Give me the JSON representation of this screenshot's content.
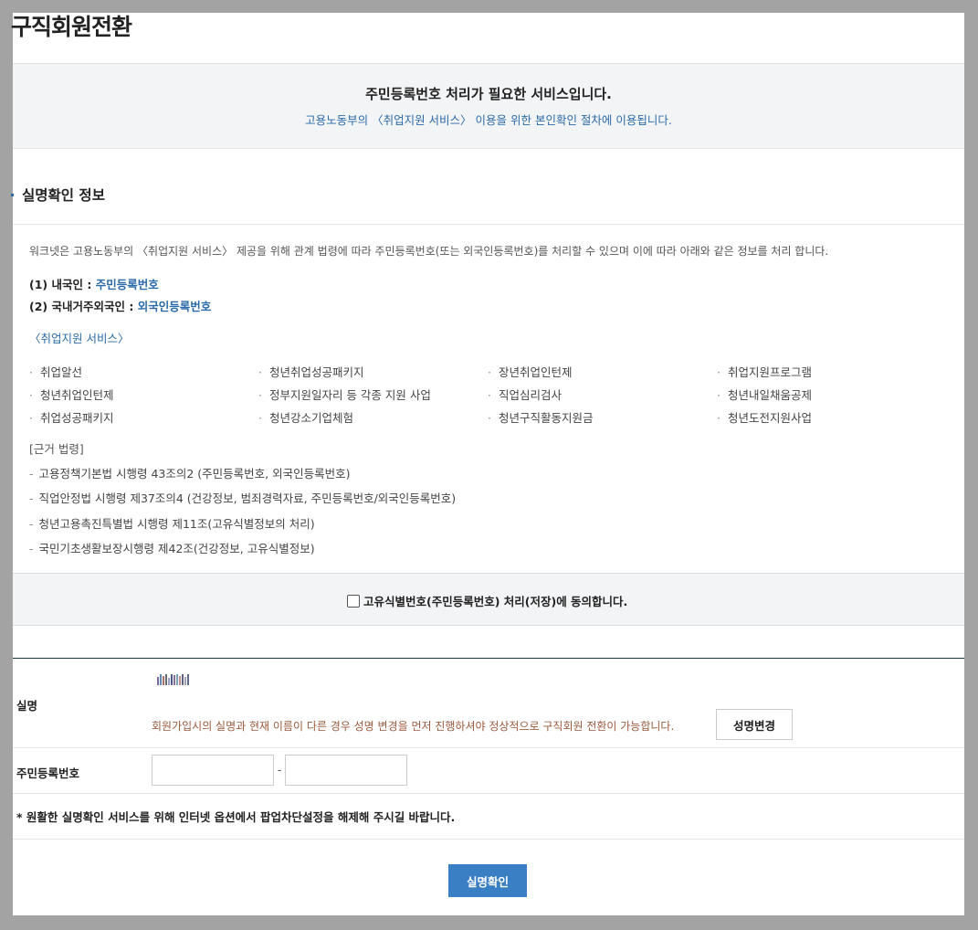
{
  "page": {
    "title": "구직회원전환"
  },
  "notice": {
    "line1": "주민등록번호 처리가 필요한 서비스입니다.",
    "line2": "고용노동부의 〈취업지원 서비스〉 이용을 위한 본인확인 절차에 이용됩니다."
  },
  "section": {
    "title": "실명확인 정보",
    "intro": "워크넷은 고용노동부의 〈취업지원 서비스〉 제공을 위해 관계 법령에 따라 주민등록번호(또는 외국인등록번호)를 처리할 수 있으며 이에 따라 아래와 같은 정보를 처리 합니다.",
    "id_types": [
      {
        "label": "(1) 내국인 : ",
        "value": "주민등록번호"
      },
      {
        "label": "(2) 국내거주외국인 : ",
        "value": "외국인등록번호"
      }
    ],
    "services_title": "〈취업지원 서비스〉",
    "services": [
      "취업알선",
      "청년취업성공패키지",
      "장년취업인턴제",
      "취업지원프로그램",
      "청년취업인턴제",
      "정부지원일자리 등 각종 지원 사업",
      "직업심리검사",
      "청년내일채움공제",
      "취업성공패키지",
      "청년강소기업체험",
      "청년구직활동지원금",
      "청년도전지원사업"
    ],
    "law_title": "[근거 법령]",
    "laws": [
      "고용정책기본법 시행령 43조의2 (주민등록번호, 외국인등록번호)",
      "직업안정법 시행령 제37조의4 (건강정보, 범죄경력자료, 주민등록번호/외국인등록번호)",
      "청년고용촉진특별법 시행령 제11조(고유식별정보의 처리)",
      "국민기초생활보장시행령 제42조(건강정보, 고유식별정보)"
    ]
  },
  "agree": {
    "label": "고유식별번호(주민등록번호) 처리(저장)에 동의합니다.",
    "checked": false
  },
  "form": {
    "name_label": "실명",
    "name_warning": "회원가입시의 실명과 현재 이름이 다른 경우 성명 변경을 먼저 진행하셔야 정상적으로 구직회원 전환이 가능합니다.",
    "change_name_button": "성명변경",
    "rrn_label": "주민등록번호",
    "rrn_first": "",
    "rrn_second": "",
    "rrn_separator": "-",
    "popup_note": "* 원활한 실명확인 서비스를 위해 인터넷 옵션에서 팝업차단설정을 해제해 주시길 바랍니다.",
    "verify_button": "실명확인"
  },
  "colors": {
    "accent_blue": "#2b6aa8",
    "button_blue": "#3a7fc4",
    "warning_brown": "#9a5a3d"
  }
}
